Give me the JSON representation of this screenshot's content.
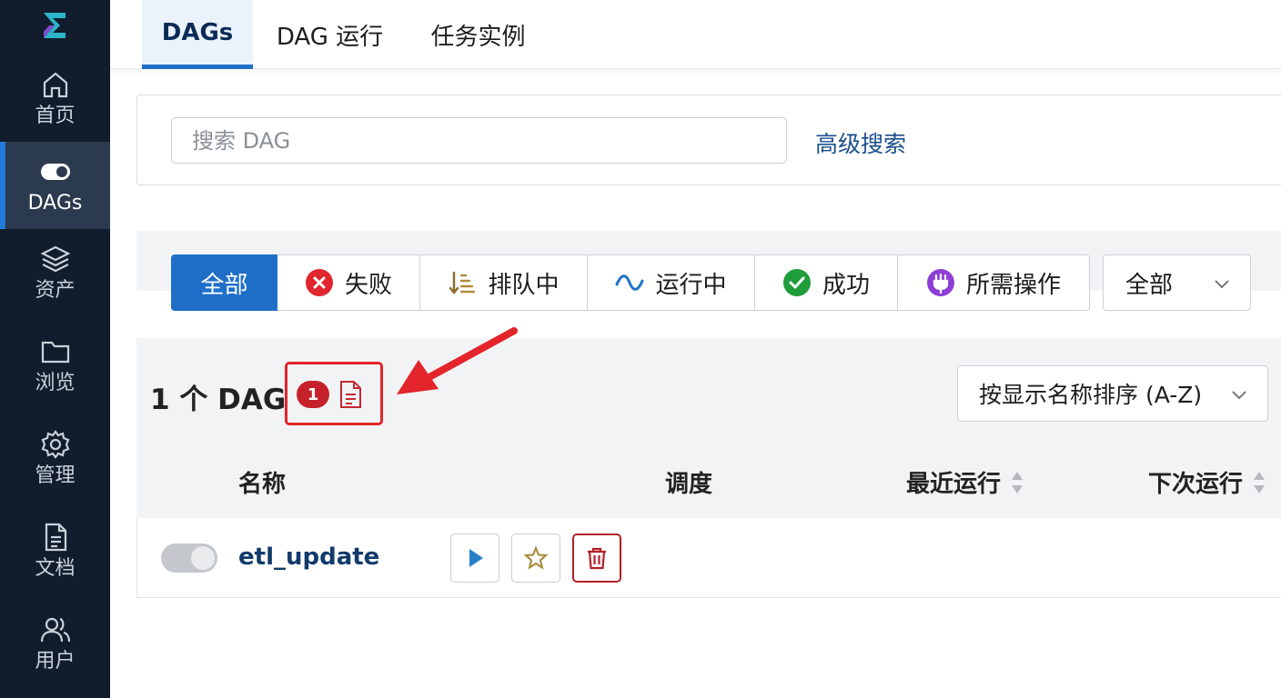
{
  "sidebar": {
    "logo": "airflow-logo",
    "items": [
      {
        "label": "首页",
        "icon": "home-icon"
      },
      {
        "label": "DAGs",
        "icon": "toggle-icon",
        "active": true
      },
      {
        "label": "资产",
        "icon": "layers-icon"
      },
      {
        "label": "浏览",
        "icon": "folder-icon"
      },
      {
        "label": "管理",
        "icon": "gear-icon"
      },
      {
        "label": "文档",
        "icon": "document-icon"
      },
      {
        "label": "用户",
        "icon": "users-icon"
      }
    ]
  },
  "tabs": [
    {
      "label": "DAGs",
      "active": true
    },
    {
      "label": "DAG 运行"
    },
    {
      "label": "任务实例"
    }
  ],
  "search": {
    "placeholder": "搜索 DAG",
    "advanced_label": "高级搜索"
  },
  "filters": {
    "buttons": [
      {
        "label": "全部",
        "active": true
      },
      {
        "label": "失败",
        "icon": "failed-icon"
      },
      {
        "label": "排队中",
        "icon": "queued-icon"
      },
      {
        "label": "运行中",
        "icon": "running-icon"
      },
      {
        "label": "成功",
        "icon": "success-icon"
      },
      {
        "label": "所需操作",
        "icon": "action-required-icon"
      }
    ],
    "dropdown_value": "全部"
  },
  "summary": {
    "count_text": "1 个 DAG",
    "badge_count": "1",
    "sort_value": "按显示名称排序 (A-Z)"
  },
  "table": {
    "headers": {
      "name": "名称",
      "schedule": "调度",
      "last_run": "最近运行",
      "next_run": "下次运行"
    },
    "rows": [
      {
        "name": "etl_update",
        "enabled": false
      }
    ]
  },
  "colors": {
    "sidebar_bg": "#111d2c",
    "accent": "#1f6fc9",
    "failed": "#e0262f",
    "success": "#1f9d3a",
    "highlight": "#e3242b"
  }
}
